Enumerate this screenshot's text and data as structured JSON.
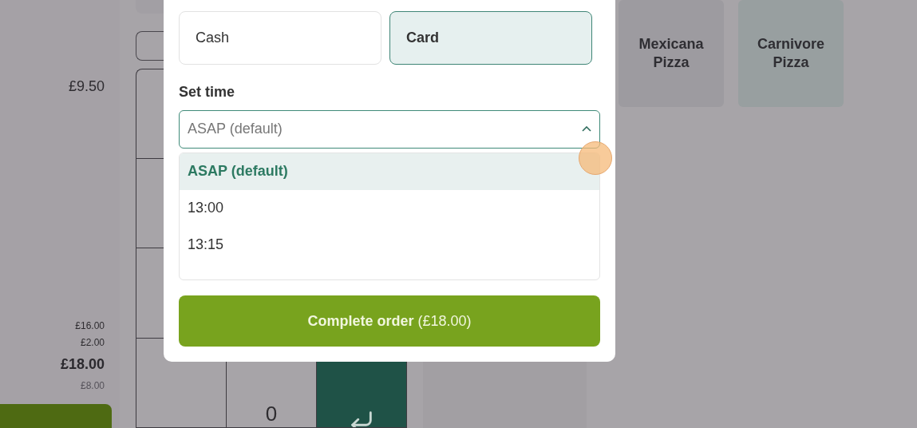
{
  "order_summary": {
    "item_price": "£9.50",
    "subtotal": "£16.00",
    "fee": "£2.00",
    "total": "£18.00",
    "remaining": "£8.00"
  },
  "keypad": {
    "keys": [
      {
        "kind": "blank"
      },
      {
        "kind": "digit",
        "label": "0"
      },
      {
        "kind": "enter"
      }
    ]
  },
  "products": [
    {
      "name": "Mexicana Pizza"
    },
    {
      "name": "Carnivore Pizza"
    }
  ],
  "modal": {
    "payment_methods": [
      {
        "label": "Cash",
        "selected": false
      },
      {
        "label": "Card",
        "selected": true
      }
    ],
    "time_label": "Set time",
    "time_select": {
      "value": "ASAP (default)",
      "expanded": true,
      "options": [
        {
          "label": "ASAP (default)",
          "selected": true
        },
        {
          "label": "13:00",
          "selected": false
        },
        {
          "label": "13:15",
          "selected": false
        }
      ]
    },
    "complete_button": "**Complete order** (£18.00)"
  }
}
